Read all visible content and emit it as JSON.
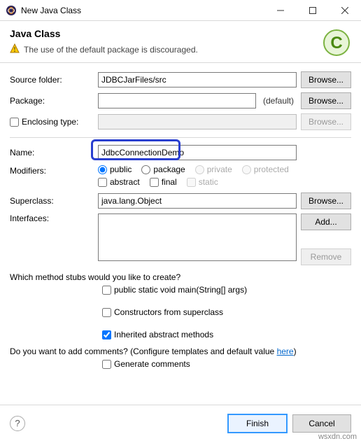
{
  "titlebar": {
    "title": "New Java Class"
  },
  "header": {
    "heading": "Java Class",
    "warning": "The use of the default package is discouraged."
  },
  "form": {
    "sourceFolder": {
      "label": "Source folder:",
      "value": "JDBCJarFiles/src",
      "browse": "Browse..."
    },
    "package": {
      "label": "Package:",
      "value": "",
      "suffix": "(default)",
      "browse": "Browse..."
    },
    "enclosingType": {
      "label": "Enclosing type:",
      "value": "",
      "browse": "Browse..."
    },
    "name": {
      "label": "Name:",
      "value": "JdbcConnectionDemo"
    },
    "modifiers": {
      "label": "Modifiers:",
      "public": "public",
      "package": "package",
      "private": "private",
      "protected": "protected",
      "abstract": "abstract",
      "final": "final",
      "static": "static"
    },
    "superclass": {
      "label": "Superclass:",
      "value": "java.lang.Object",
      "browse": "Browse..."
    },
    "interfaces": {
      "label": "Interfaces:",
      "add": "Add...",
      "remove": "Remove"
    }
  },
  "stubs": {
    "question": "Which method stubs would you like to create?",
    "main": "public static void main(String[] args)",
    "constructors": "Constructors from superclass",
    "inherited": "Inherited abstract methods"
  },
  "comments": {
    "question_prefix": "Do you want to add comments? (Configure templates and default value ",
    "link": "here",
    "question_suffix": ")",
    "generate": "Generate comments"
  },
  "footer": {
    "finish": "Finish",
    "cancel": "Cancel"
  },
  "watermark": "wsxdn.com"
}
